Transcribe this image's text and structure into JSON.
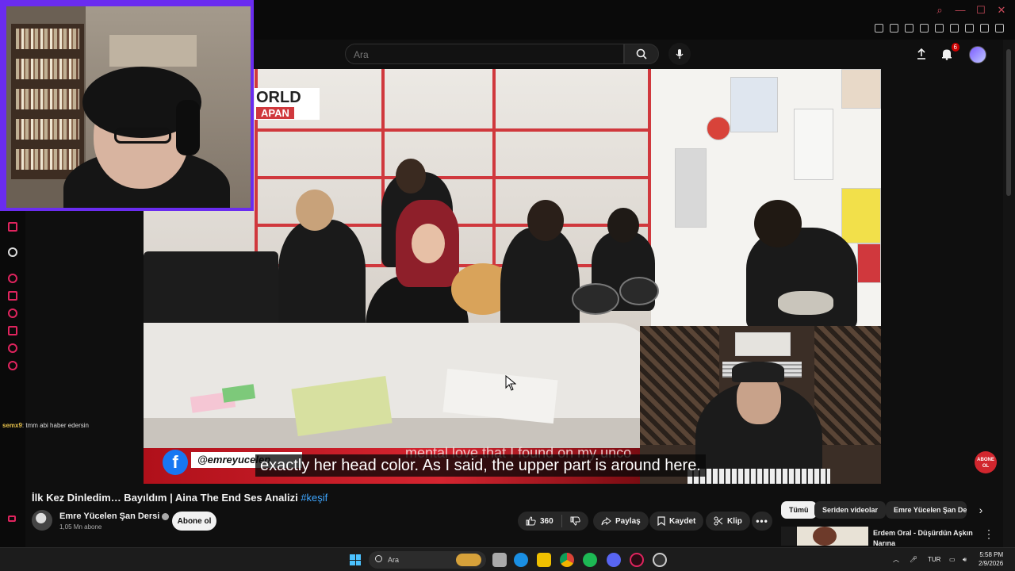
{
  "header": {
    "search_placeholder": "Ara",
    "notification_count": "6"
  },
  "video": {
    "world_text": "ORLD",
    "japan_text": "APAN",
    "fb_letter": "f",
    "handle": "@emreyucelen",
    "ghost_subtitle": "mental love that I found on my unco",
    "caption": "exactly her head color. As I said, the upper part is around here."
  },
  "chat": {
    "user": "semx9",
    "message": ": tmm abi haber edersin"
  },
  "info": {
    "title": "İlk Kez Dinledim… Bayıldım | Aina The End Ses Analizi",
    "hashtag": "#keşif",
    "channel_name": "Emre Yücelen Şan Dersi",
    "subscribers": "1,05 Mn abone",
    "subscribe_label": "Abone ol",
    "like_count": "360",
    "share_label": "Paylaş",
    "save_label": "Kaydet",
    "clip_label": "Klip"
  },
  "chips": [
    "Tümü",
    "Seriden videolar",
    "Emre Yücelen Şan De"
  ],
  "recommended": {
    "title": "Erdem Oral - Düşürdün Aşkın Narına"
  },
  "abone_logo": "ABONE OL",
  "taskbar": {
    "search_label": "Ara",
    "language": "TUR",
    "time": "5:58 PM",
    "date": "2/9/2026"
  },
  "colors": {
    "accent_purple": "#6a2cf0",
    "link_blue": "#3ea6ff",
    "brand_red": "#cc0000"
  }
}
